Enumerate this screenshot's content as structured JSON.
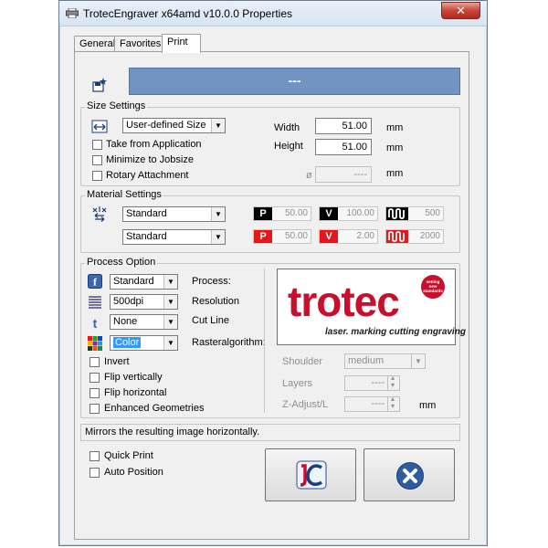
{
  "window": {
    "title": "TrotecEngraver x64amd v10.0.0 Properties",
    "close_label": "✕"
  },
  "tabs": [
    {
      "label": "General",
      "active": false
    },
    {
      "label": "Favorites",
      "active": false
    },
    {
      "label": "Print",
      "active": true
    }
  ],
  "job_banner": "---",
  "size_settings": {
    "title": "Size Settings",
    "size_select": "User-defined Size",
    "take_from_application": "Take from Application",
    "minimize_to_jobsize": "Minimize to Jobsize",
    "rotary_attachment": "Rotary Attachment",
    "width_label": "Width",
    "width_value": "51.00",
    "width_unit": "mm",
    "height_label": "Height",
    "height_value": "51.00",
    "height_unit": "mm",
    "diameter_symbol": "ø",
    "diameter_value": "----",
    "diameter_unit": "mm"
  },
  "material_settings": {
    "title": "Material Settings",
    "material_select_1": "Standard",
    "material_select_2": "Standard",
    "row1": {
      "p_badge": "P",
      "p_value": "50.00",
      "v_badge": "V",
      "v_value": "100.00",
      "w_value": "500"
    },
    "row2": {
      "p_badge": "P",
      "p_value": "50.00",
      "v_badge": "V",
      "v_value": "2.00",
      "w_value": "2000"
    },
    "colors": {
      "engrave": "#000000",
      "cut": "#e8151b"
    }
  },
  "process_option": {
    "title": "Process Option",
    "process_select": "Standard",
    "process_label": "Process:",
    "resolution_select": "500dpi",
    "resolution_label": "Resolution",
    "cutline_select": "None",
    "cutline_label": "Cut Line",
    "raster_select": "Color",
    "raster_label": "Rasteralgorithm:",
    "invert": "Invert",
    "flip_vertically": "Flip vertically",
    "flip_horizontal": "Flip horizontal",
    "enhanced_geometries": "Enhanced Geometries",
    "shoulder_label": "Shoulder",
    "shoulder_select": "medium",
    "layers_label": "Layers",
    "layers_value": "----",
    "zadjust_label": "Z-Adjust/L",
    "zadjust_value": "----",
    "zadjust_unit": "mm"
  },
  "logo": {
    "brand": "trotec",
    "tagline": "laser. marking cutting engraving",
    "seal": "setting new standards",
    "color": "#c8102e"
  },
  "status_text": "Mirrors the resulting image horizontally.",
  "bottom": {
    "quick_print": "Quick Print",
    "auto_position": "Auto Position"
  }
}
